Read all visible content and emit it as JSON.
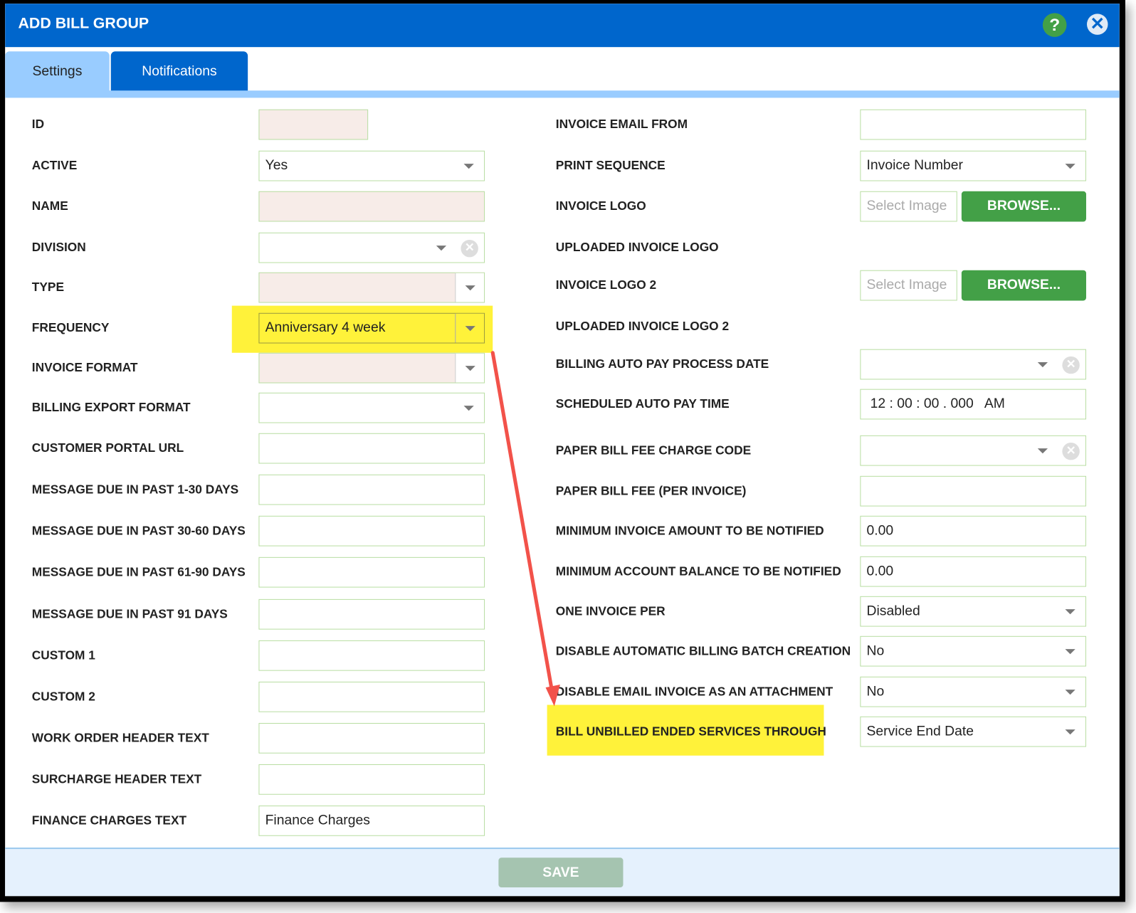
{
  "dialog": {
    "title": "ADD BILL GROUP",
    "help_icon": "?",
    "close_icon": "✕"
  },
  "tabs": [
    {
      "label": "Settings",
      "active": true
    },
    {
      "label": "Notifications",
      "active": false
    }
  ],
  "left_fields": [
    {
      "label": "ID",
      "value": ""
    },
    {
      "label": "ACTIVE",
      "value": "Yes"
    },
    {
      "label": "NAME",
      "value": ""
    },
    {
      "label": "DIVISION",
      "value": ""
    },
    {
      "label": "TYPE",
      "value": ""
    },
    {
      "label": "FREQUENCY",
      "value": "Anniversary 4 week"
    },
    {
      "label": "INVOICE FORMAT",
      "value": ""
    },
    {
      "label": "BILLING EXPORT FORMAT",
      "value": ""
    },
    {
      "label": "CUSTOMER PORTAL URL",
      "value": ""
    },
    {
      "label": "MESSAGE DUE IN PAST 1-30 DAYS",
      "value": ""
    },
    {
      "label": "MESSAGE DUE IN PAST 30-60 DAYS",
      "value": ""
    },
    {
      "label": "MESSAGE DUE IN PAST 61-90 DAYS",
      "value": ""
    },
    {
      "label": "MESSAGE DUE IN PAST 91 DAYS",
      "value": ""
    },
    {
      "label": "CUSTOM 1",
      "value": ""
    },
    {
      "label": "CUSTOM 2",
      "value": ""
    },
    {
      "label": "WORK ORDER HEADER TEXT",
      "value": ""
    },
    {
      "label": "SURCHARGE HEADER TEXT",
      "value": ""
    },
    {
      "label": "FINANCE CHARGES TEXT",
      "value": "Finance Charges"
    }
  ],
  "right_fields": [
    {
      "label": "INVOICE EMAIL FROM",
      "value": ""
    },
    {
      "label": "PRINT SEQUENCE",
      "value": "Invoice Number"
    },
    {
      "label": "INVOICE LOGO",
      "placeholder": "Select Image",
      "button": "BROWSE..."
    },
    {
      "label": "UPLOADED INVOICE LOGO"
    },
    {
      "label": "INVOICE LOGO 2",
      "placeholder": "Select Image",
      "button": "BROWSE..."
    },
    {
      "label": "UPLOADED INVOICE LOGO 2"
    },
    {
      "label": "BILLING AUTO PAY PROCESS DATE",
      "value": ""
    },
    {
      "label": "SCHEDULED AUTO PAY TIME",
      "value": "12 : 00 : 00 . 000   AM"
    },
    {
      "label": "PAPER BILL FEE CHARGE CODE",
      "value": ""
    },
    {
      "label": "PAPER BILL FEE (PER INVOICE)",
      "value": ""
    },
    {
      "label": "MINIMUM INVOICE AMOUNT TO BE NOTIFIED",
      "value": "0.00"
    },
    {
      "label": "MINIMUM ACCOUNT BALANCE TO BE NOTIFIED",
      "value": "0.00"
    },
    {
      "label": "ONE INVOICE PER",
      "value": "Disabled"
    },
    {
      "label": "DISABLE AUTOMATIC BILLING BATCH CREATION",
      "value": "No"
    },
    {
      "label": "DISABLE EMAIL INVOICE AS AN ATTACHMENT",
      "value": "No"
    },
    {
      "label": "BILL UNBILLED ENDED SERVICES THROUGH",
      "value": "Service End Date"
    }
  ],
  "footer": {
    "save_label": "SAVE"
  },
  "colors": {
    "header": "#0066cc",
    "highlight": "#fff23a",
    "annotation_arrow": "#f2524a",
    "browse": "#43a047",
    "save_disabled": "#a5c4b0"
  }
}
